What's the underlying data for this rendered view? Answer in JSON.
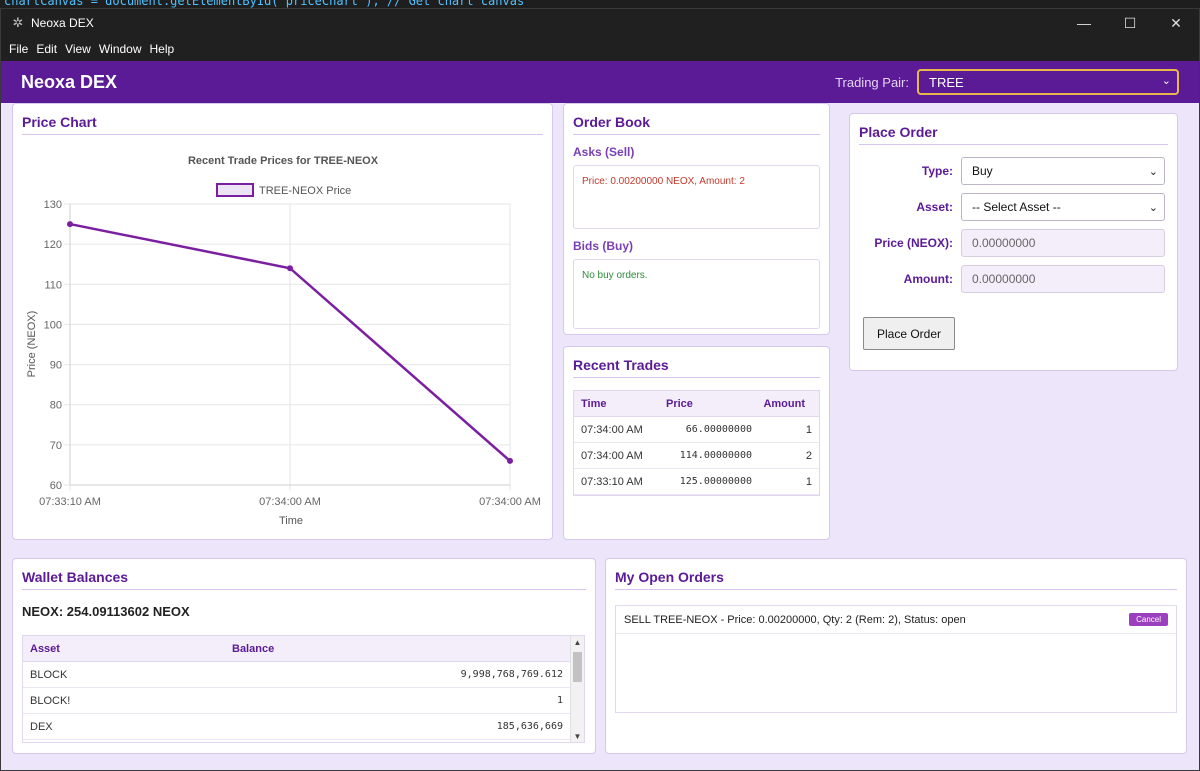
{
  "code_fragment": "chartCanvas = document.getElementById('priceChart'); // Get chart canvas",
  "window": {
    "title": "Neoxa DEX",
    "minimize": "—",
    "maximize": "☐",
    "close": "✕"
  },
  "menu": [
    "File",
    "Edit",
    "View",
    "Window",
    "Help"
  ],
  "header": {
    "brand": "Neoxa DEX",
    "pair_label": "Trading Pair:",
    "pair_value": "TREE"
  },
  "price_chart": {
    "heading": "Price Chart"
  },
  "chart_data": {
    "type": "line",
    "title": "Recent Trade Prices for TREE-NEOX",
    "legend": [
      "TREE-NEOX Price"
    ],
    "legend_position": "top",
    "xlabel": "Time",
    "ylabel": "Price (NEOX)",
    "categories": [
      "07:33:10 AM",
      "07:34:00 AM",
      "07:34:00 AM"
    ],
    "series": [
      {
        "name": "TREE-NEOX Price",
        "values": [
          125,
          114,
          66
        ]
      }
    ],
    "ylim": [
      60,
      130
    ],
    "yticks": [
      60,
      70,
      80,
      90,
      100,
      110,
      120,
      130
    ],
    "grid": true,
    "color": "#7b1fa2"
  },
  "order_book": {
    "heading": "Order Book",
    "asks_label": "Asks (Sell)",
    "asks_text": "Price: 0.00200000 NEOX, Amount: 2",
    "bids_label": "Bids (Buy)",
    "bids_text": "No buy orders."
  },
  "recent_trades": {
    "heading": "Recent Trades",
    "columns": [
      "Time",
      "Price",
      "Amount"
    ],
    "rows": [
      [
        "07:34:00 AM",
        "66.00000000",
        "1"
      ],
      [
        "07:34:00 AM",
        "114.00000000",
        "2"
      ],
      [
        "07:33:10 AM",
        "125.00000000",
        "1"
      ]
    ]
  },
  "place_order": {
    "heading": "Place Order",
    "type_label": "Type:",
    "type_value": "Buy",
    "asset_label": "Asset:",
    "asset_value": "-- Select Asset --",
    "price_label": "Price (NEOX):",
    "price_placeholder": "0.00000000",
    "amount_label": "Amount:",
    "amount_placeholder": "0.00000000",
    "submit_label": "Place Order"
  },
  "wallet": {
    "heading": "Wallet Balances",
    "total": "NEOX: 254.09113602 NEOX",
    "columns": [
      "Asset",
      "Balance"
    ],
    "rows": [
      [
        "BLOCK",
        "9,998,768,769.612"
      ],
      [
        "BLOCK!",
        "1"
      ],
      [
        "DEX",
        "185,636,669"
      ]
    ]
  },
  "open_orders": {
    "heading": "My Open Orders",
    "items": [
      {
        "text": "SELL TREE-NEOX - Price: 0.00200000, Qty: 2 (Rem: 2), Status: open",
        "action": "Cancel"
      }
    ]
  },
  "colors": {
    "brand": "#5b1a96",
    "accent": "#e8b84c",
    "asks": "#c0392b",
    "bids": "#2e8b3a",
    "cancel": "#9b3fbf"
  }
}
